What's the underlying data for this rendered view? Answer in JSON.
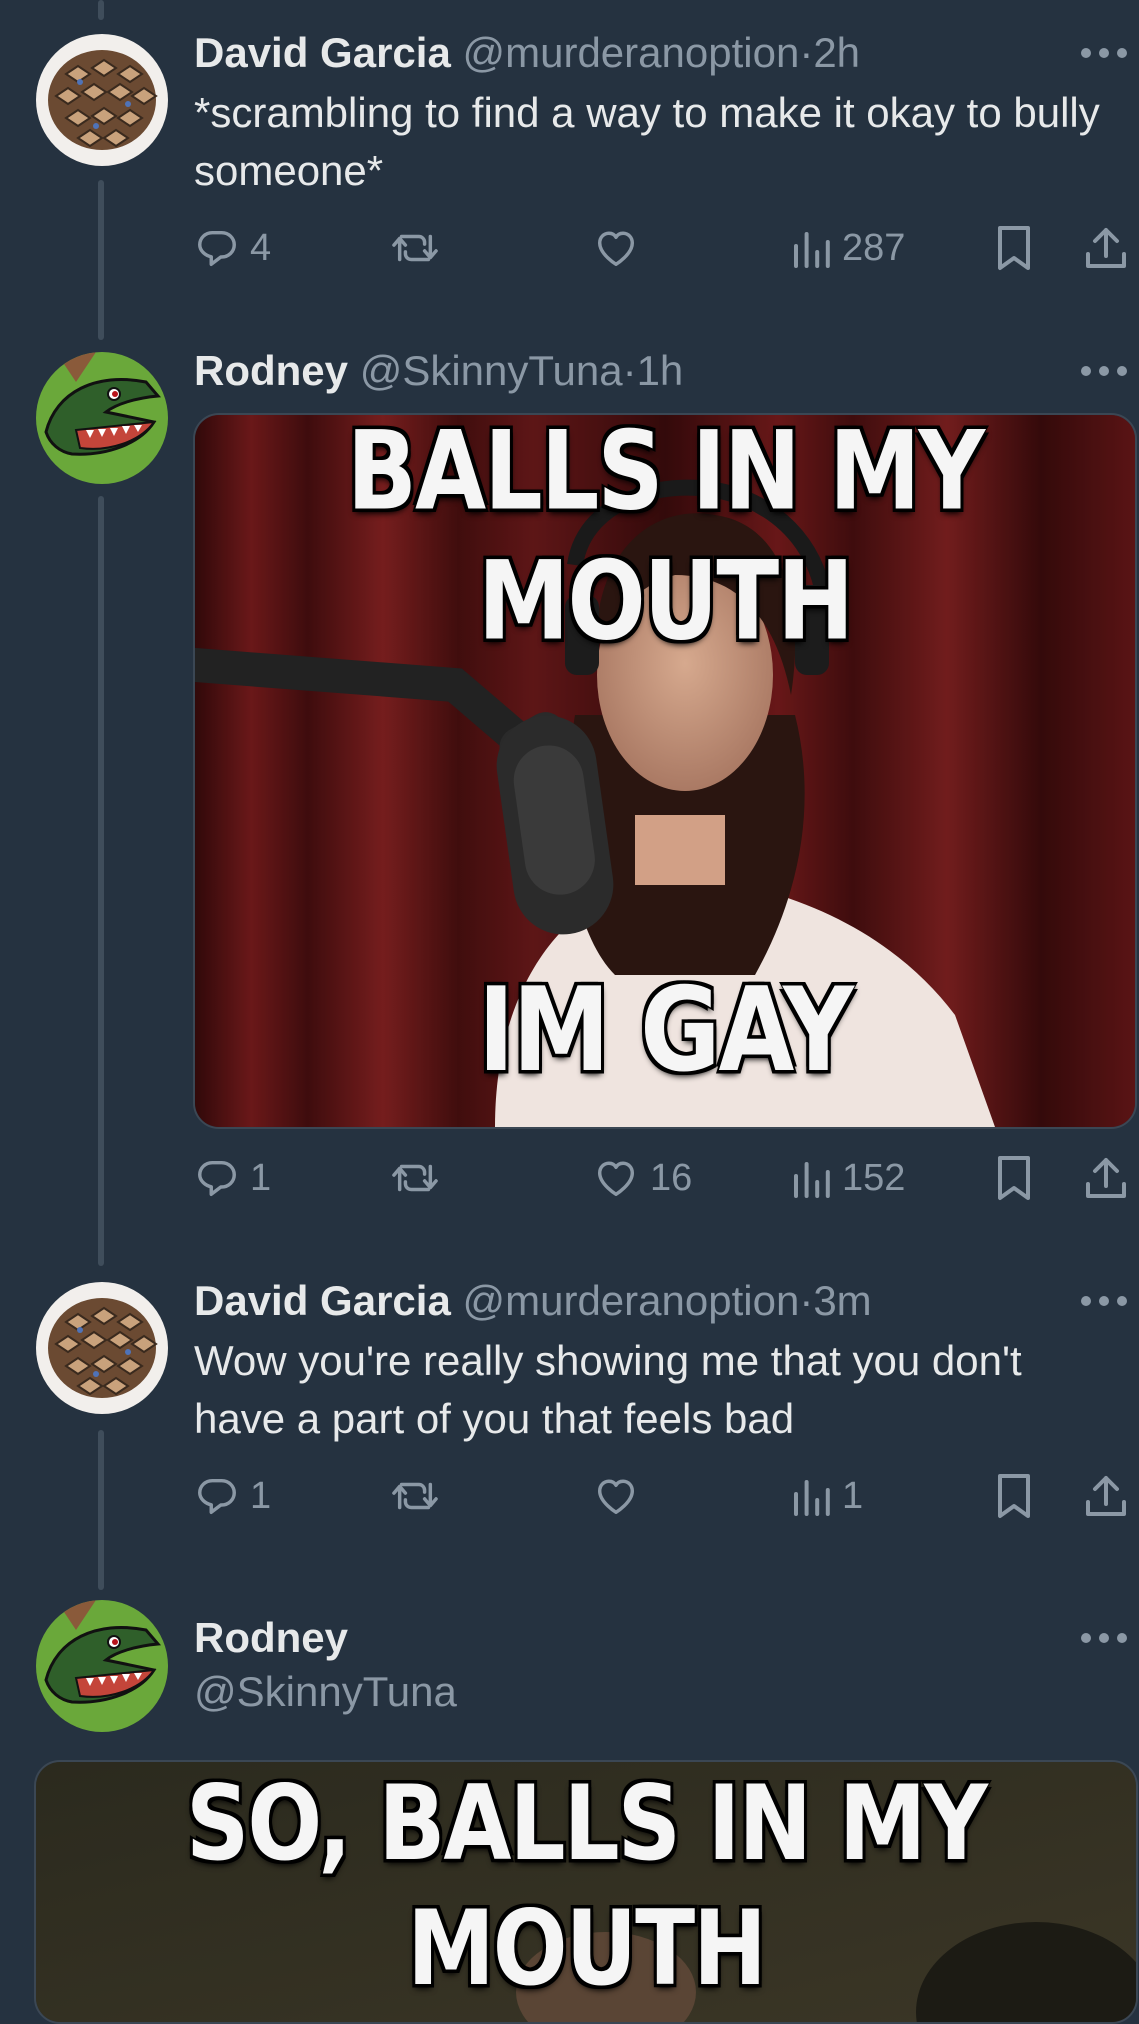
{
  "tweets": [
    {
      "name": "David Garcia",
      "handle": "@murderanoption",
      "dot": "·",
      "time": "2h",
      "text": "*scrambling to find a way to make it okay to bully someone*",
      "replies": "4",
      "retweets": "",
      "likes": "",
      "views": "287"
    },
    {
      "name": "Rodney",
      "handle": "@SkinnyTuna",
      "dot": "·",
      "time": "1h",
      "media_top_text": "BALLS IN MY MOUTH",
      "media_bottom_text": "IM GAY",
      "replies": "1",
      "retweets": "",
      "likes": "16",
      "views": "152"
    },
    {
      "name": "David Garcia",
      "handle": "@murderanoption",
      "dot": "·",
      "time": "3m",
      "text": "Wow you're really showing me that you don't have a part of you that feels bad",
      "replies": "1",
      "retweets": "",
      "likes": "",
      "views": "1"
    },
    {
      "name": "Rodney",
      "handle": "@SkinnyTuna",
      "media_top_text": "SO, BALLS IN MY MOUTH"
    }
  ],
  "icons": {
    "reply": "reply-icon",
    "retweet": "retweet-icon",
    "like": "heart-icon",
    "views": "views-icon",
    "bookmark": "bookmark-icon",
    "share": "share-icon",
    "more": "more-icon"
  },
  "colors": {
    "background": "#253240",
    "text": "#e7e9ea",
    "muted": "#8b98a5",
    "thread_line": "#3f4d5b"
  }
}
